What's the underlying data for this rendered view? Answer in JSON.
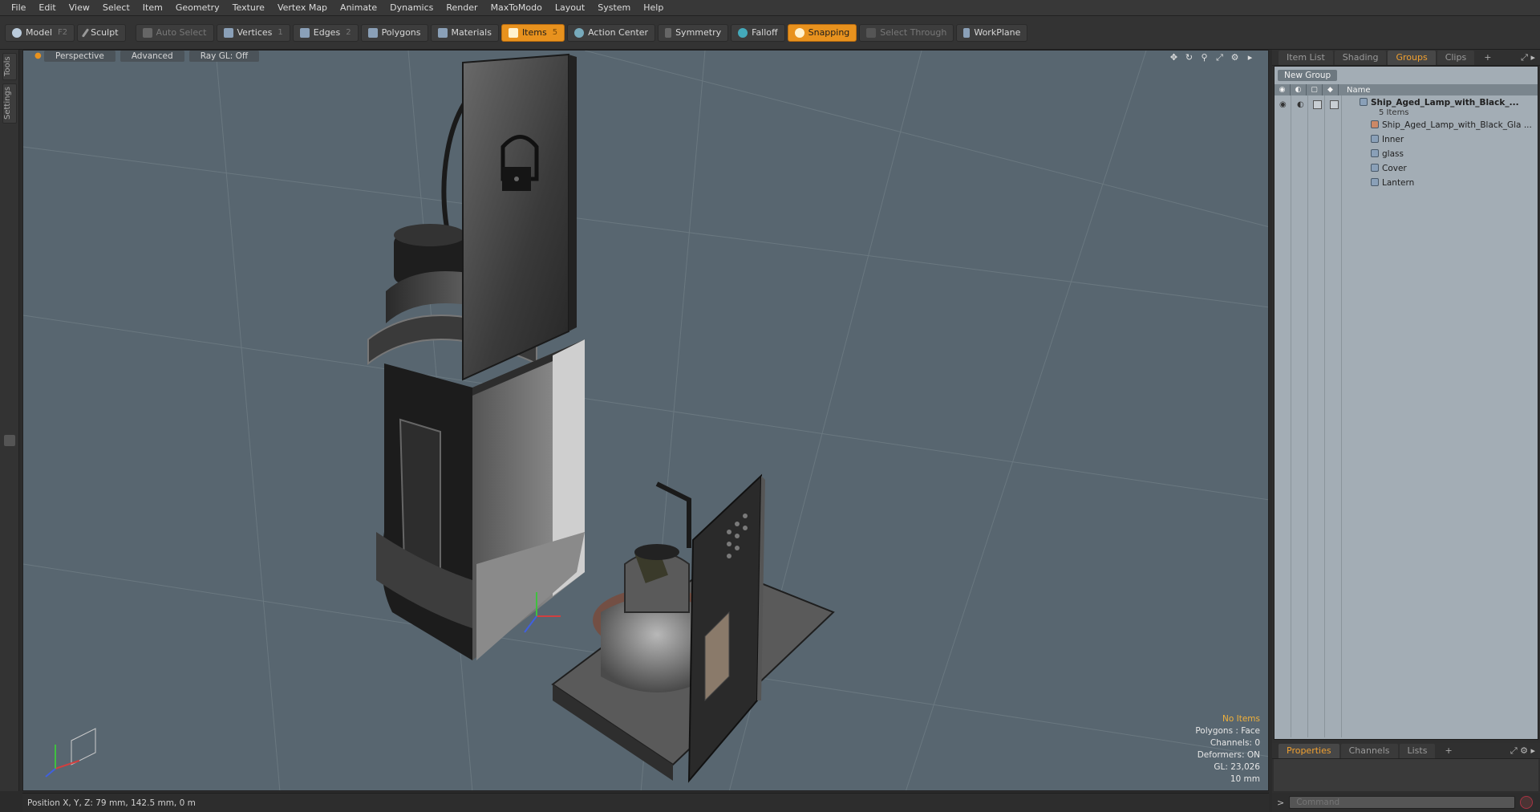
{
  "menu": [
    "File",
    "Edit",
    "View",
    "Select",
    "Item",
    "Geometry",
    "Texture",
    "Vertex Map",
    "Animate",
    "Dynamics",
    "Render",
    "MaxToModo",
    "Layout",
    "System",
    "Help"
  ],
  "toolbar": {
    "model": "Model",
    "model_key": "F2",
    "sculpt": "Sculpt",
    "auto_select": "Auto Select",
    "vertices": "Vertices",
    "vertices_key": "1",
    "edges": "Edges",
    "edges_key": "2",
    "polygons": "Polygons",
    "materials": "Materials",
    "items": "Items",
    "items_key": "5",
    "action_center": "Action Center",
    "symmetry": "Symmetry",
    "falloff": "Falloff",
    "snapping": "Snapping",
    "select_through": "Select Through",
    "workplane": "WorkPlane",
    "accent": "#e8921e"
  },
  "left_tabs": [
    "Tools",
    "Settings"
  ],
  "viewport": {
    "view": "Perspective",
    "shading": "Advanced",
    "raygl": "Ray GL: Off",
    "info": {
      "no_items": "No Items",
      "polygons": "Polygons : Face",
      "channels": "Channels: 0",
      "deformers": "Deformers: ON",
      "gl": "GL: 23,026",
      "scale": "10 mm"
    }
  },
  "status": {
    "position": "Position X, Y, Z:  79 mm, 142.5 mm, 0 m"
  },
  "panel": {
    "tabs": [
      "Item List",
      "Shading",
      "Groups",
      "Clips",
      "+"
    ],
    "active_tab": "Groups",
    "new_group": "New Group",
    "name_col": "Name",
    "root": {
      "name": "Ship_Aged_Lamp_with_Black_...",
      "count": "5 Items"
    },
    "children": [
      "Ship_Aged_Lamp_with_Black_Gla ...",
      "Inner",
      "glass",
      "Cover",
      "Lantern"
    ],
    "bottom_tabs": [
      "Properties",
      "Channels",
      "Lists",
      "+"
    ],
    "bottom_active": "Properties",
    "command_placeholder": "Command"
  }
}
